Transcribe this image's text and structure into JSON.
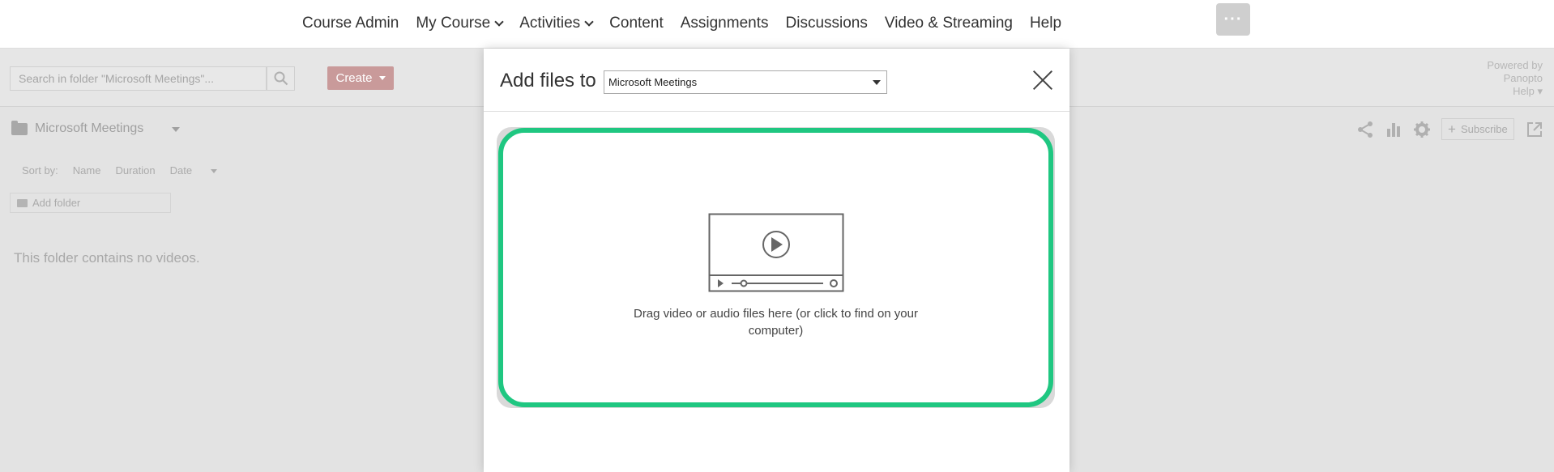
{
  "nav": {
    "items": [
      {
        "label": "Course Admin",
        "dropdown": false
      },
      {
        "label": "My Course",
        "dropdown": true
      },
      {
        "label": "Activities",
        "dropdown": true
      },
      {
        "label": "Content",
        "dropdown": false
      },
      {
        "label": "Assignments",
        "dropdown": false
      },
      {
        "label": "Discussions",
        "dropdown": false
      },
      {
        "label": "Video & Streaming",
        "dropdown": false
      },
      {
        "label": "Help",
        "dropdown": false
      }
    ],
    "more_label": "···"
  },
  "panopto": {
    "search": {
      "placeholder": "Search in folder \"Microsoft Meetings\"..."
    },
    "create_label": "Create",
    "powered_by": "Powered by",
    "brand": "Panopto",
    "help_label": "Help",
    "folder_name": "Microsoft Meetings",
    "sort": {
      "label": "Sort by:",
      "options": [
        "Name",
        "Duration",
        "Date"
      ]
    },
    "add_folder_label": "Add folder",
    "empty_message": "This folder contains no videos.",
    "subscribe_label": "Subscribe"
  },
  "modal": {
    "title": "Add files to",
    "selected_folder": "Microsoft Meetings",
    "drop_text": "Drag video or audio files here (or click to find on your computer)"
  },
  "colors": {
    "dropzone_border": "#1fc781",
    "create_button": "#c99a9a"
  }
}
